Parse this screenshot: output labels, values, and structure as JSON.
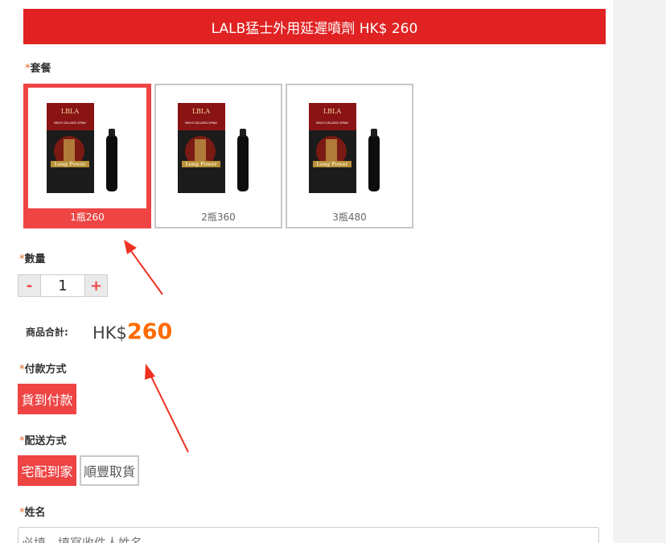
{
  "header": {
    "title": "LALB猛士外用延遲噴劑 HK$ 260"
  },
  "labels": {
    "required_mark": "*",
    "package": "套餐",
    "quantity": "數量",
    "total": "商品合計:",
    "payment": "付款方式",
    "shipping": "配送方式",
    "name": "姓名"
  },
  "packages": [
    {
      "caption": "1瓶260",
      "selected": true
    },
    {
      "caption": "2瓶360",
      "selected": false
    },
    {
      "caption": "3瓶480",
      "selected": false
    }
  ],
  "product_image": {
    "brand": "LBLA",
    "subtitle": "MEN'S DELAYED SPRAY",
    "logo_text": "Long Power"
  },
  "quantity": {
    "minus": "-",
    "value": "1",
    "plus": "+"
  },
  "total": {
    "currency": "HK$",
    "amount": "260"
  },
  "payment": {
    "options": [
      "貨到付款"
    ]
  },
  "shipping": {
    "options": [
      "宅配到家",
      "順豐取貨"
    ]
  },
  "name_field": {
    "placeholder": "必填，填寫收件人姓名"
  },
  "colors": {
    "accent": "#e02222",
    "selected": "#ee4444",
    "price": "#ff6a00",
    "arrow": "#ee3322"
  }
}
